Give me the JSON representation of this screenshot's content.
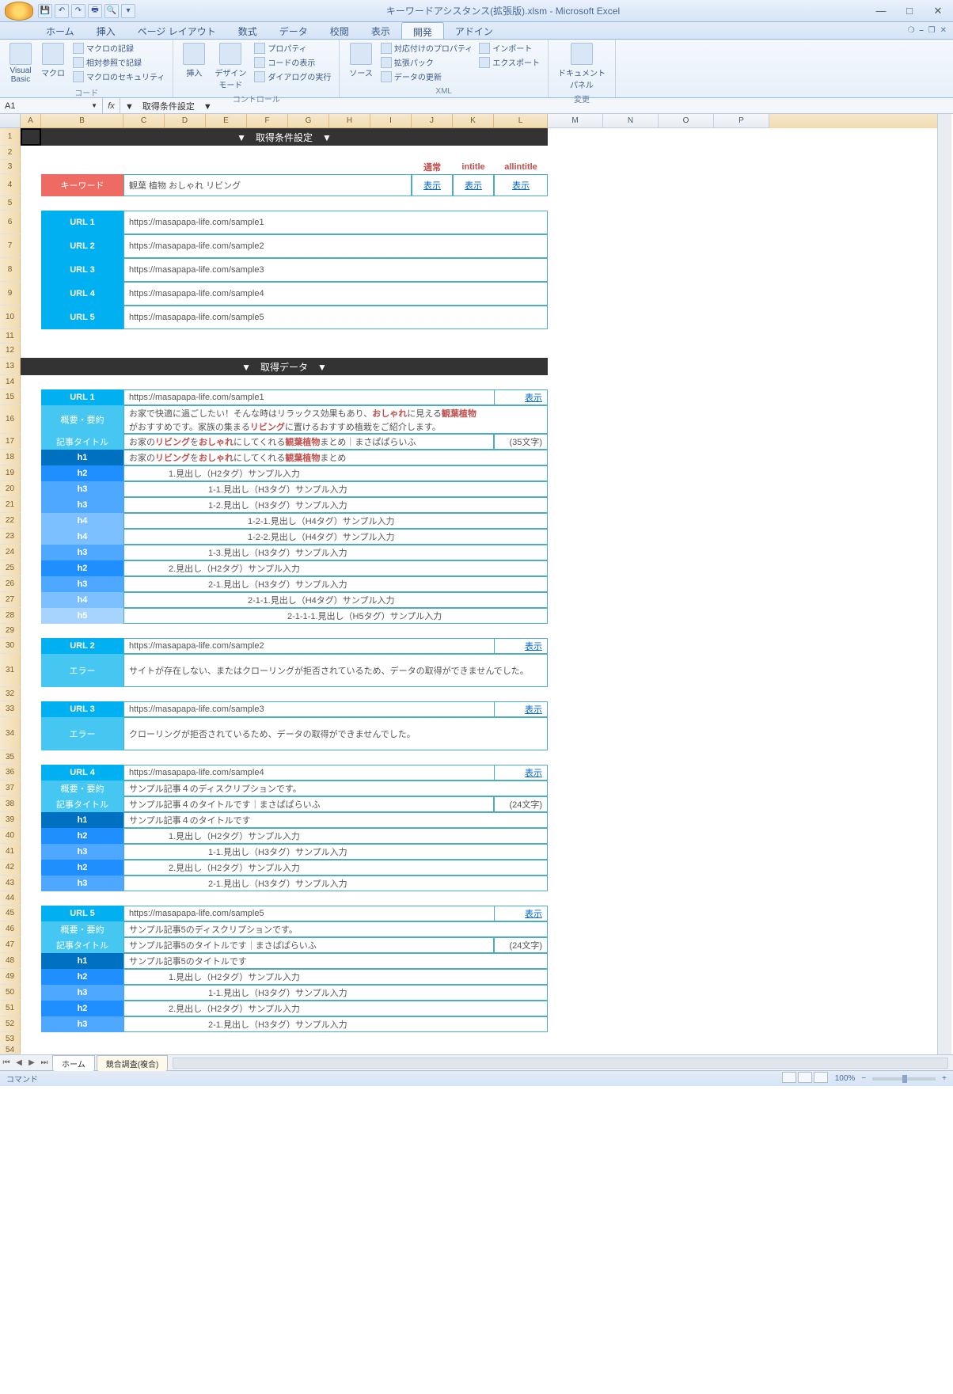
{
  "app": {
    "title": "キーワードアシスタンス(拡張版).xlsm - Microsoft Excel"
  },
  "win": {
    "min": "—",
    "max": "□",
    "close": "✕"
  },
  "tabs": {
    "home": "ホーム",
    "insert": "挿入",
    "pagelayout": "ページ レイアウト",
    "formulas": "数式",
    "data": "データ",
    "review": "校閲",
    "view": "表示",
    "developer": "開発",
    "addin": "アドイン"
  },
  "ribbon": {
    "code": {
      "label": "コード",
      "vb": "Visual\nBasic",
      "macro": "マクロ",
      "rec": "マクロの記録",
      "rel": "相対参照で記録",
      "sec": "マクロのセキュリティ"
    },
    "ctrl": {
      "label": "コントロール",
      "ins": "挿入",
      "design": "デザイン\nモード",
      "prop": "プロパティ",
      "code": "コードの表示",
      "dlg": "ダイアログの実行"
    },
    "xml": {
      "label": "XML",
      "src": "ソース",
      "map": "対応付けのプロパティ",
      "ext": "拡張パック",
      "ref": "データの更新",
      "imp": "インポート",
      "exp": "エクスポート"
    },
    "chg": {
      "label": "変更",
      "doc": "ドキュメント\nパネル"
    }
  },
  "namebox": "A1",
  "formula": "▼　取得条件設定　▼",
  "cols": [
    "A",
    "B",
    "C",
    "D",
    "E",
    "F",
    "G",
    "H",
    "I",
    "J",
    "K",
    "L",
    "M",
    "N",
    "O",
    "P"
  ],
  "sheet": {
    "section1": "▼　取得条件設定　▼",
    "section2": "▼　取得データ　▼",
    "mode": {
      "normal": "通常",
      "intitle": "intitle",
      "allintitle": "allintitle"
    },
    "kw_label": "キーワード",
    "kw_value": "観葉 植物 おしゃれ リビング",
    "show": "表示",
    "url_label": [
      "URL 1",
      "URL 2",
      "URL 3",
      "URL 4",
      "URL 5"
    ],
    "url_val": [
      "https://masapapa-life.com/sample1",
      "https://masapapa-life.com/sample2",
      "https://masapapa-life.com/sample3",
      "https://masapapa-life.com/sample4",
      "https://masapapa-life.com/sample5"
    ],
    "summary_label": "概要・要約",
    "title_label": "記事タイトル",
    "error_label": "エラー",
    "chars35": "(35文字)",
    "chars24": "(24文字)",
    "u1": {
      "summary_p1": "お家で快適に過ごしたい！そんな時はリラックス効果もあり、",
      "summary_kw1": "おしゃれ",
      "summary_p2": "に見える",
      "summary_kw2": "観葉植物",
      "summary_p3": "がおすすめです。家族の集まる",
      "summary_kw3": "リビング",
      "summary_p4": "に置けるおすすめ植栽をご紹介します。",
      "title_p1": "お家の",
      "title_kw1": "リビング",
      "title_p2": "を",
      "title_kw2": "おしゃれ",
      "title_p3": "にしてくれる",
      "title_kw3": "観葉植物",
      "title_p4": "まとめ｜まさぱぱらいふ",
      "h1_p1": "お家の",
      "h1_kw1": "リビング",
      "h1_p2": "を",
      "h1_kw2": "おしゃれ",
      "h1_p3": "にしてくれる",
      "h1_kw3": "観葉植物",
      "h1_p4": "まとめ",
      "rows": [
        {
          "lv": "h2",
          "txt": "1.見出し（H2タグ）サンプル入力",
          "indent": 1
        },
        {
          "lv": "h3",
          "txt": "1-1.見出し（H3タグ）サンプル入力",
          "indent": 2
        },
        {
          "lv": "h3",
          "txt": "1-2.見出し（H3タグ）サンプル入力",
          "indent": 2
        },
        {
          "lv": "h4",
          "txt": "1-2-1.見出し（H4タグ）サンプル入力",
          "indent": 3
        },
        {
          "lv": "h4",
          "txt": "1-2-2.見出し（H4タグ）サンプル入力",
          "indent": 3
        },
        {
          "lv": "h3",
          "txt": "1-3.見出し（H3タグ）サンプル入力",
          "indent": 2
        },
        {
          "lv": "h2",
          "txt": "2.見出し（H2タグ）サンプル入力",
          "indent": 1
        },
        {
          "lv": "h3",
          "txt": "2-1.見出し（H3タグ）サンプル入力",
          "indent": 2
        },
        {
          "lv": "h4",
          "txt": "2-1-1.見出し（H4タグ）サンプル入力",
          "indent": 3
        },
        {
          "lv": "h5",
          "txt": "2-1-1-1.見出し（H5タグ）サンプル入力",
          "indent": 4
        }
      ]
    },
    "u2": {
      "err": "サイトが存在しない、またはクローリングが拒否されているため、データの取得ができませんでした。"
    },
    "u3": {
      "err": "クローリングが拒否されているため、データの取得ができませんでした。"
    },
    "u4": {
      "summary": "サンプル記事４のディスクリプションです。",
      "title": "サンプル記事４のタイトルです｜まさぱぱらいふ",
      "h1": "サンプル記事４のタイトルです",
      "rows": [
        {
          "lv": "h2",
          "txt": "1.見出し（H2タグ）サンプル入力",
          "indent": 1
        },
        {
          "lv": "h3",
          "txt": "1-1.見出し（H3タグ）サンプル入力",
          "indent": 2
        },
        {
          "lv": "h2",
          "txt": "2.見出し（H2タグ）サンプル入力",
          "indent": 1
        },
        {
          "lv": "h3",
          "txt": "2-1.見出し（H3タグ）サンプル入力",
          "indent": 2
        }
      ]
    },
    "u5": {
      "summary": "サンプル記事5のディスクリプションです。",
      "title": "サンプル記事5のタイトルです｜まさぱぱらいふ",
      "h1": "サンプル記事5のタイトルです",
      "rows": [
        {
          "lv": "h2",
          "txt": "1.見出し（H2タグ）サンプル入力",
          "indent": 1
        },
        {
          "lv": "h3",
          "txt": "1-1.見出し（H3タグ）サンプル入力",
          "indent": 2
        },
        {
          "lv": "h2",
          "txt": "2.見出し（H2タグ）サンプル入力",
          "indent": 1
        },
        {
          "lv": "h3",
          "txt": "2-1.見出し（H3タグ）サンプル入力",
          "indent": 2
        }
      ]
    }
  },
  "sheettabs": {
    "home": "ホーム",
    "kyo": "競合調査(複合)"
  },
  "status": {
    "ready": "コマンド",
    "zoom": "100%"
  }
}
